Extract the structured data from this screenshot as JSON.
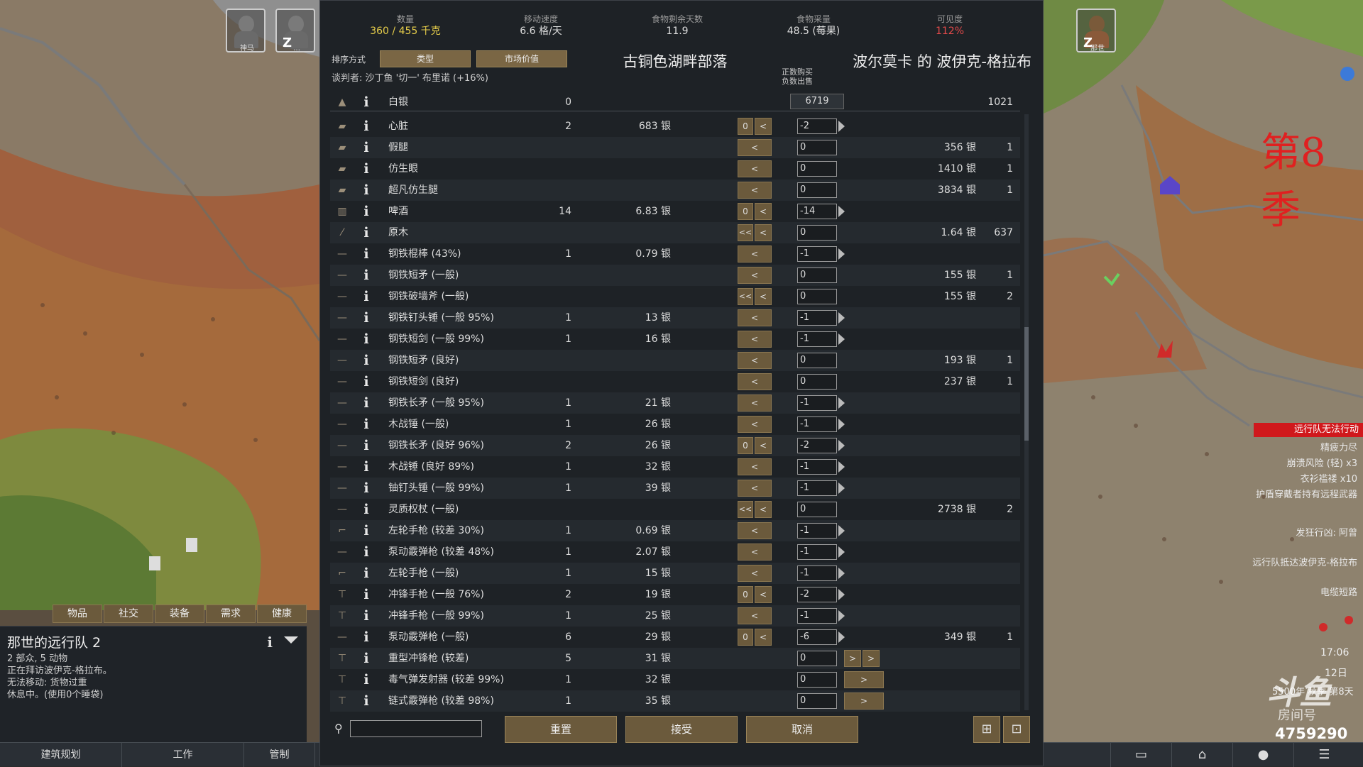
{
  "left_tabs": [
    "物品",
    "社交",
    "装备",
    "需求",
    "健康"
  ],
  "inspect": {
    "title": "那世的远行队 2",
    "lines": [
      "2 部众, 5 动物",
      "正在拜访波伊克-格拉布。",
      "无法移动: 货物过重",
      "休息中。(使用0个睡袋)"
    ]
  },
  "bottom_bar": {
    "build": "建筑规划",
    "work": "工作",
    "restrict": "管制"
  },
  "stats": [
    {
      "label": "数量",
      "value": "360 / 455 千克",
      "color": "yellow"
    },
    {
      "label": "移动速度",
      "value": "6.6 格/天",
      "color": "normal"
    },
    {
      "label": "食物剩余天数",
      "value": "11.9",
      "color": "normal"
    },
    {
      "label": "食物采量",
      "value": "48.5 (莓果)",
      "color": "normal"
    },
    {
      "label": "可见度",
      "value": "112%",
      "color": "red"
    }
  ],
  "sort": {
    "label": "排序方式",
    "btn1": "类型",
    "btn2": "市场价值"
  },
  "faction_name": "古铜色湖畔部落",
  "trader_name": "波尔莫卡 的 波伊克-格拉布",
  "negotiator": "谈判者: 沙丁鱼 '切一' 布里诺 (+16%)",
  "hint": "正数购买\n负数出售",
  "silver": {
    "name": "白银",
    "count": "0",
    "value": "6719",
    "trader_count": "1021"
  },
  "rows": [
    {
      "name": "心脏",
      "count": "2",
      "price": "683 银",
      "ctrl": "zero-lt",
      "field": "-2",
      "tri": true,
      "tprice": "",
      "tcount": ""
    },
    {
      "name": "假腿",
      "count": "",
      "price": "",
      "ctrl": "lt",
      "field": "0",
      "tri": false,
      "tprice": "356 银",
      "tcount": "1"
    },
    {
      "name": "仿生眼",
      "count": "",
      "price": "",
      "ctrl": "lt",
      "field": "0",
      "tri": false,
      "tprice": "1410 银",
      "tcount": "1"
    },
    {
      "name": "超凡仿生腿",
      "count": "",
      "price": "",
      "ctrl": "lt",
      "field": "0",
      "tri": false,
      "tprice": "3834 银",
      "tcount": "1"
    },
    {
      "name": "啤酒",
      "count": "14",
      "price": "6.83 银",
      "ctrl": "zero-lt",
      "field": "-14",
      "tri": true,
      "tprice": "",
      "tcount": ""
    },
    {
      "name": "原木",
      "count": "",
      "price": "",
      "ctrl": "dbl-lt",
      "field": "0",
      "tri": false,
      "tprice": "1.64 银",
      "tcount": "637"
    },
    {
      "name": "钢铁棍棒 (43%)",
      "count": "1",
      "price": "0.79 银",
      "ctrl": "lt",
      "field": "-1",
      "tri": true,
      "tprice": "",
      "tcount": ""
    },
    {
      "name": "钢铁短矛 (一般)",
      "count": "",
      "price": "",
      "ctrl": "lt",
      "field": "0",
      "tri": false,
      "tprice": "155 银",
      "tcount": "1"
    },
    {
      "name": "钢铁破墙斧 (一般)",
      "count": "",
      "price": "",
      "ctrl": "dbl-lt",
      "field": "0",
      "tri": false,
      "tprice": "155 银",
      "tcount": "2"
    },
    {
      "name": "钢铁钉头锤 (一般 95%)",
      "count": "1",
      "price": "13 银",
      "ctrl": "lt",
      "field": "-1",
      "tri": true,
      "tprice": "",
      "tcount": ""
    },
    {
      "name": "钢铁短剑 (一般 99%)",
      "count": "1",
      "price": "16 银",
      "ctrl": "lt",
      "field": "-1",
      "tri": true,
      "tprice": "",
      "tcount": ""
    },
    {
      "name": "钢铁短矛 (良好)",
      "count": "",
      "price": "",
      "ctrl": "lt",
      "field": "0",
      "tri": false,
      "tprice": "193 银",
      "tcount": "1"
    },
    {
      "name": "钢铁短剑 (良好)",
      "count": "",
      "price": "",
      "ctrl": "lt",
      "field": "0",
      "tri": false,
      "tprice": "237 银",
      "tcount": "1"
    },
    {
      "name": "钢铁长矛 (一般 95%)",
      "count": "1",
      "price": "21 银",
      "ctrl": "lt",
      "field": "-1",
      "tri": true,
      "tprice": "",
      "tcount": ""
    },
    {
      "name": "木战锤 (一般)",
      "count": "1",
      "price": "26 银",
      "ctrl": "lt",
      "field": "-1",
      "tri": true,
      "tprice": "",
      "tcount": ""
    },
    {
      "name": "钢铁长矛 (良好 96%)",
      "count": "2",
      "price": "26 银",
      "ctrl": "zero-lt",
      "field": "-2",
      "tri": true,
      "tprice": "",
      "tcount": ""
    },
    {
      "name": "木战锤 (良好 89%)",
      "count": "1",
      "price": "32 银",
      "ctrl": "lt",
      "field": "-1",
      "tri": true,
      "tprice": "",
      "tcount": ""
    },
    {
      "name": "铀钉头锤 (一般 99%)",
      "count": "1",
      "price": "39 银",
      "ctrl": "lt",
      "field": "-1",
      "tri": true,
      "tprice": "",
      "tcount": ""
    },
    {
      "name": "灵质权杖 (一般)",
      "count": "",
      "price": "",
      "ctrl": "dbl-lt",
      "field": "0",
      "tri": false,
      "tprice": "2738 银",
      "tcount": "2"
    },
    {
      "name": "左轮手枪 (较差 30%)",
      "count": "1",
      "price": "0.69 银",
      "ctrl": "lt",
      "field": "-1",
      "tri": true,
      "tprice": "",
      "tcount": ""
    },
    {
      "name": "泵动霰弹枪 (较差 48%)",
      "count": "1",
      "price": "2.07 银",
      "ctrl": "lt",
      "field": "-1",
      "tri": true,
      "tprice": "",
      "tcount": ""
    },
    {
      "name": "左轮手枪 (一般)",
      "count": "1",
      "price": "15 银",
      "ctrl": "lt",
      "field": "-1",
      "tri": true,
      "tprice": "",
      "tcount": ""
    },
    {
      "name": "冲锋手枪 (一般 76%)",
      "count": "2",
      "price": "19 银",
      "ctrl": "zero-lt",
      "field": "-2",
      "tri": true,
      "tprice": "",
      "tcount": ""
    },
    {
      "name": "冲锋手枪 (一般 99%)",
      "count": "1",
      "price": "25 银",
      "ctrl": "lt",
      "field": "-1",
      "tri": true,
      "tprice": "",
      "tcount": ""
    },
    {
      "name": "泵动霰弹枪 (一般)",
      "count": "6",
      "price": "29 银",
      "ctrl": "zero-lt",
      "field": "-6",
      "tri": true,
      "tprice": "349 银",
      "tcount": "1"
    },
    {
      "name": "重型冲锋枪 (较差)",
      "count": "5",
      "price": "31 银",
      "ctrl": "gt-gt",
      "field": "0",
      "tri": false,
      "tprice": "",
      "tcount": ""
    },
    {
      "name": "毒气弹发射器 (较差 99%)",
      "count": "1",
      "price": "32 银",
      "ctrl": "gt",
      "field": "0",
      "tri": false,
      "tprice": "",
      "tcount": ""
    },
    {
      "name": "链式霰弹枪 (较差 98%)",
      "count": "1",
      "price": "35 银",
      "ctrl": "gt",
      "field": "0",
      "tri": false,
      "tprice": "",
      "tcount": ""
    }
  ],
  "buttons": {
    "reset": "重置",
    "accept": "接受",
    "cancel": "取消"
  },
  "glyphs": {
    "info": "i",
    "lt": "<",
    "dbl_lt": "<<",
    "gt": ">",
    "zero": "0"
  },
  "overlays": {
    "season": "第8季",
    "alert_red": "远行队无法行动",
    "alerts": [
      "精疲力尽",
      "崩溃风险 (轻) x3",
      "衣衫褴褛 x10",
      "护盾穿戴者持有远程武器",
      "发狂行凶: 阿曾",
      "远行队抵达波伊克-格拉布",
      "电缆短路"
    ],
    "clock": "17:06",
    "date1": "12日",
    "date2": "5500年 秋季 第8天",
    "viewer_count": "4759290",
    "watermark": "斗鱼",
    "watermark2": "房间号"
  },
  "pawns": [
    {
      "name": "神马"
    },
    {
      "name": "…"
    },
    {
      "name": "那世"
    }
  ],
  "colors": {
    "accent_button": "#6b5a3c",
    "panel": "#1e2226",
    "red_alert": "#d0181c",
    "yellow_text": "#e6cd4a"
  }
}
